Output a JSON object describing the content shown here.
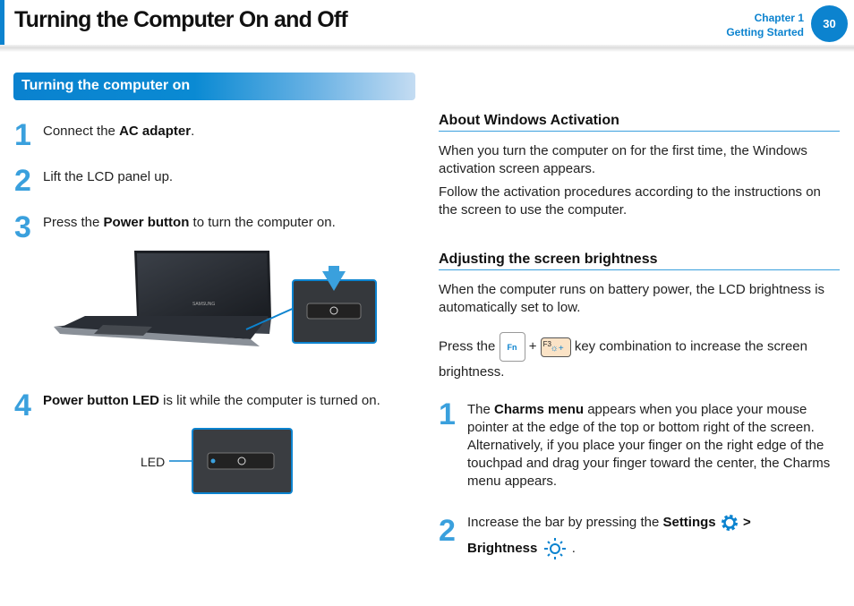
{
  "header": {
    "title": "Turning the Computer On and Off",
    "chapter": "Chapter 1",
    "chapter_name": "Getting Started",
    "page_number": "30",
    "accent": "#0c83cf"
  },
  "left": {
    "section_title": "Turning the computer on",
    "steps": [
      {
        "num": "1",
        "pre": "Connect the ",
        "bold": "AC adapter",
        "post": "."
      },
      {
        "num": "2",
        "pre": "Lift the LCD panel up.",
        "bold": "",
        "post": ""
      },
      {
        "num": "3",
        "pre": "Press the ",
        "bold": "Power button",
        "post": " to turn the computer on."
      },
      {
        "num": "4",
        "pre": "",
        "bold": "Power button LED",
        "post": " is lit while the computer is turned on."
      }
    ],
    "laptop_brand": "SAMSUNG",
    "led_label": "LED"
  },
  "right": {
    "activation": {
      "heading": "About Windows Activation",
      "p1": "When you turn the computer on for the first time, the Windows activation screen appears.",
      "p2": "Follow the activation procedures according to the instructions on the screen to use the computer."
    },
    "brightness": {
      "heading": "Adjusting the screen brightness",
      "p1": "When the computer runs on battery power, the LCD brightness is automatically set to low.",
      "press_pre": "Press the",
      "plus": "+",
      "press_post": "key combination to increase the screen",
      "press_end": "brightness.",
      "key_fn": "Fn",
      "key_f3": "F3",
      "steps": [
        {
          "num": "1",
          "pre": "The ",
          "bold": "Charms menu",
          "post": " appears when you place your mouse pointer at the edge of the top or bottom right of the screen. Alternatively, if you place your finger on the right edge of the touchpad and drag your finger toward the center, the Charms menu appears."
        },
        {
          "num": "2",
          "pre": "Increase the bar by pressing the ",
          "bold": "Settings",
          "sep": ">",
          "bold2": "Brightness",
          "end": "."
        }
      ]
    }
  }
}
